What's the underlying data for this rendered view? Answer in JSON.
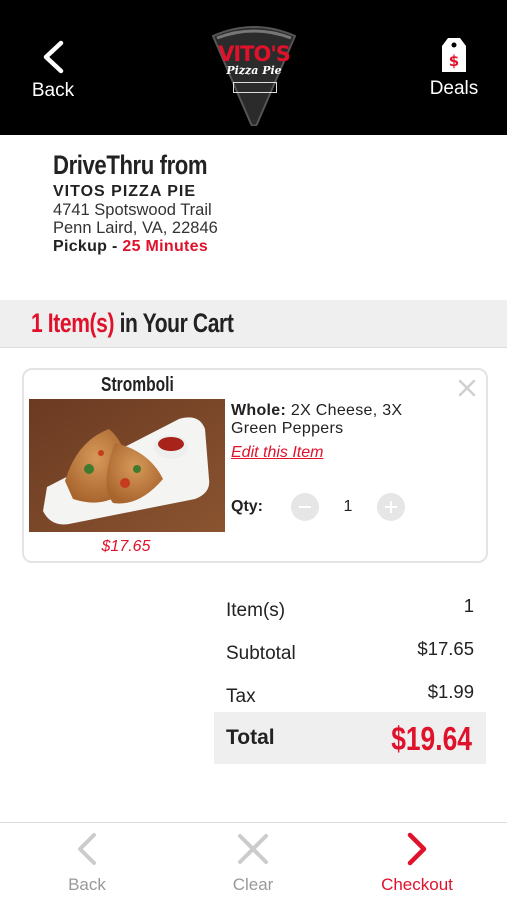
{
  "top_nav": {
    "back_label": "Back",
    "deals_label": "Deals",
    "logo_text": "VITO'S",
    "logo_subtext": "Pizza Pie"
  },
  "location": {
    "title": "DriveThru from",
    "store_name": "VITOS PIZZA PIE",
    "address_line1": "4741 Spotswood Trail",
    "address_line2": "Penn Laird, VA, 22846",
    "pickup_label": "Pickup -",
    "pickup_time": "25 Minutes"
  },
  "cart": {
    "count_text": "1 Item(s)",
    "heading_rest": "in Your Cart",
    "items": [
      {
        "name": "Stromboli",
        "price": "$17.65",
        "size_label": "Whole:",
        "toppings": "2X Cheese, 3X Green Peppers",
        "edit_label": "Edit this Item",
        "qty_label": "Qty:",
        "qty": "1"
      }
    ]
  },
  "summary": {
    "items_label": "Item(s)",
    "items_value": "1",
    "subtotal_label": "Subtotal",
    "subtotal_value": "$17.65",
    "tax_label": "Tax",
    "tax_value": "$1.99",
    "total_label": "Total",
    "total_value": "$19.64"
  },
  "bottom_bar": {
    "back_label": "Back",
    "clear_label": "Clear",
    "checkout_label": "Checkout"
  },
  "colors": {
    "accent": "#e0112b",
    "header_bg": "#000000",
    "band_bg": "#efefef"
  },
  "icons": [
    "chevron-left-icon",
    "price-tag-icon",
    "close-icon",
    "minus-icon",
    "plus-icon",
    "chevron-right-icon"
  ]
}
